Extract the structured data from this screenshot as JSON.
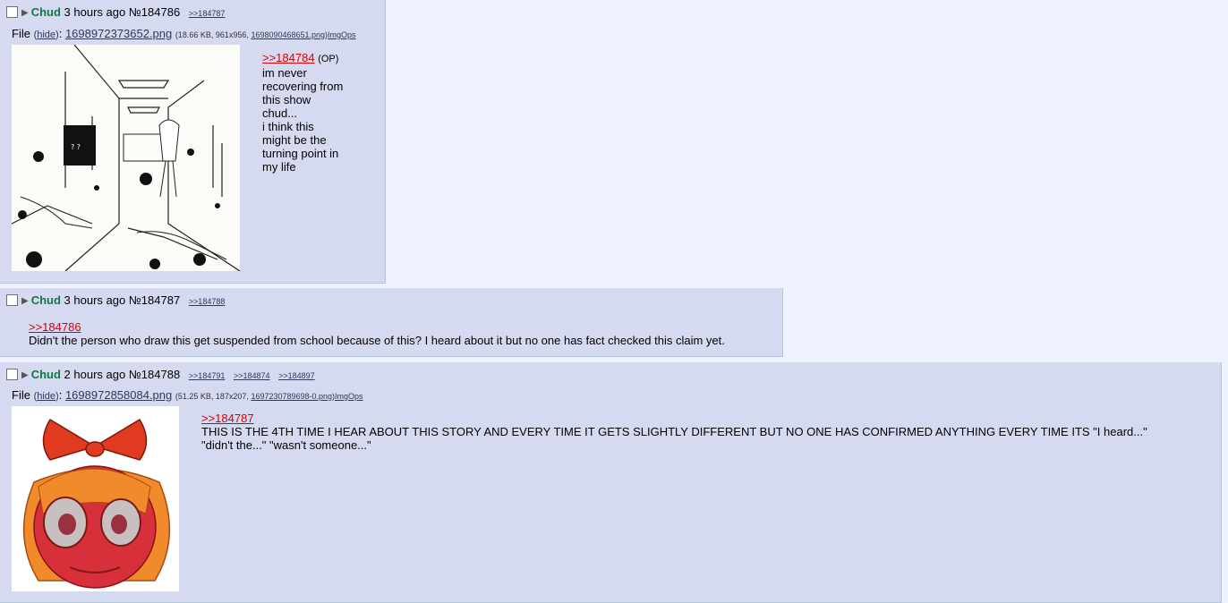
{
  "posts": [
    {
      "name": "Chud",
      "time": "3 hours ago",
      "no": "№184786",
      "backlinks": [
        ">>184787"
      ],
      "file": {
        "label": "File",
        "hide": "hide",
        "filename": "1698972373652.png",
        "size_dims": "(18.66 KB, 961x956, ",
        "orig": "1698090468651.png",
        "imgops": "ImgOps"
      },
      "quote": ">>184784",
      "op": "(OP)",
      "lines": [
        "im never",
        "recovering from",
        "this show",
        "chud...",
        "i think this",
        "might be the",
        "turning point in",
        "my life"
      ]
    },
    {
      "name": "Chud",
      "time": "3 hours ago",
      "no": "№184787",
      "backlinks": [
        ">>184788"
      ],
      "quote": ">>184786",
      "lines": [
        "Didn't the person who draw this get suspended from school because of this? I heard about it but no one has fact checked this claim yet."
      ]
    },
    {
      "name": "Chud",
      "time": "2 hours ago",
      "no": "№184788",
      "backlinks": [
        ">>184791",
        ">>184874",
        ">>184897"
      ],
      "file": {
        "label": "File",
        "hide": "hide",
        "filename": "1698972858084.png",
        "size_dims": "(51.25 KB, 187x207, ",
        "orig": "1697230789698-0.png",
        "imgops": "ImgOps"
      },
      "quote": ">>184787",
      "lines": [
        "THIS IS THE 4TH TIME I HEAR ABOUT THIS STORY AND EVERY TIME IT GETS SLIGHTLY DIFFERENT BUT NO ONE HAS CONFIRMED ANYTHING EVERY TIME ITS \"I heard...\"",
        "\"didn't the...\" \"wasn't someone...\""
      ]
    }
  ]
}
